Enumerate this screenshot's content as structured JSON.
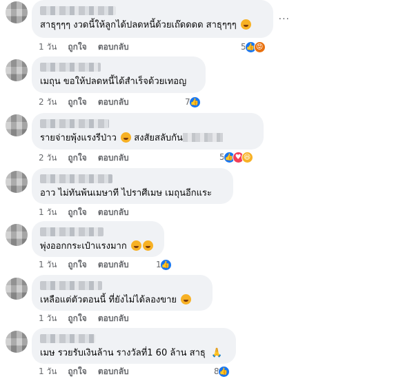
{
  "actions": {
    "like": "ถูกใจ",
    "reply": "ตอบกลับ",
    "more": "···"
  },
  "comments": [
    {
      "text": "สาธุๆๆๆ งวดนี้ให้ลูกได้ปลดหนี้ด้วยเถ๊ดดดด สาธุๆๆๆ",
      "time": "1 วัน",
      "reactions": "5",
      "icons": [
        "like-icon",
        "angry-icon"
      ]
    },
    {
      "text": "เมถุน ขอให้ปลดหนี้ได้สำเร็จด้วยเทอญ",
      "time": "2 วัน",
      "reactions": "7",
      "icons": [
        "like-icon"
      ]
    },
    {
      "text": "รายจ่ายพุ้งแรงรีป่าว",
      "text2": "สงสัยสลับกัน",
      "time": "2 วัน",
      "reactions": "5",
      "icons": [
        "like-icon",
        "love-icon",
        "haha-icon"
      ]
    },
    {
      "text": "อาว ไม่ทันพ้นเมษาที ไปราศีเมษ เมถุนอีกแระ",
      "time": "1 วัน",
      "reactions": "",
      "icons": []
    },
    {
      "text": "พุ่งออกกระเป๋าแรงมาก",
      "time": "1 วัน",
      "reactions": "1",
      "icons": [
        "like-icon"
      ]
    },
    {
      "text": "เหลือแต่ตัวตอนนี้ ที่ยังไม่ได้ลองขาย",
      "time": "1 วัน",
      "reactions": "",
      "icons": []
    },
    {
      "text": "เมษ รวยรับเงินล้าน รางวัลที่1 60 ล้าน สาธุ",
      "time": "1 วัน",
      "reactions": "8",
      "icons": [
        "like-icon"
      ]
    }
  ]
}
